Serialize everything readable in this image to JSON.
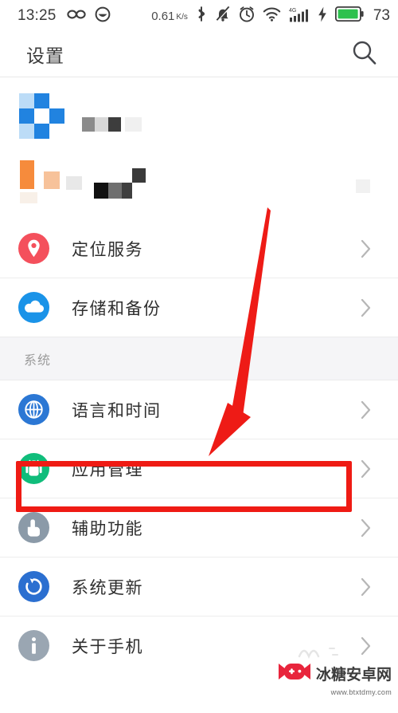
{
  "statusbar": {
    "time": "13:25",
    "net_speed_value": "0.61",
    "net_speed_unit": "K/s",
    "battery_percent": "73",
    "icons": [
      "infinity-icon",
      "smiley-icon",
      "bluetooth-icon",
      "mute-icon",
      "alarm-icon",
      "wifi-icon",
      "signal-4g-icon",
      "charging-bolt-icon",
      "battery-icon"
    ],
    "signal_label": "4G"
  },
  "header": {
    "title": "设置",
    "search_icon": "search-icon"
  },
  "list": {
    "censored_rows": [
      {
        "name": "censored-row-1",
        "icon_color": "#2586e0"
      },
      {
        "name": "censored-row-2",
        "icon_color": "#f68b3c"
      }
    ],
    "items": [
      {
        "label": "定位服务",
        "icon": "location-pin-icon",
        "icon_color": "#f4505c",
        "chevron": "chevron-right-icon",
        "highlighted": false
      },
      {
        "label": "存储和备份",
        "icon": "cloud-icon",
        "icon_color": "#1a93e8",
        "chevron": "chevron-right-icon",
        "highlighted": false
      }
    ],
    "section_title": "系统",
    "system_items": [
      {
        "label": "语言和时间",
        "icon": "globe-icon",
        "icon_color": "#2b77d4",
        "chevron": "chevron-right-icon",
        "highlighted": false
      },
      {
        "label": "应用管理",
        "icon": "android-robot-icon",
        "icon_color": "#10bd7b",
        "chevron": "chevron-right-icon",
        "highlighted": true
      },
      {
        "label": "辅助功能",
        "icon": "hand-pointer-icon",
        "icon_color": "#8b9aa8",
        "chevron": "chevron-right-icon",
        "highlighted": false
      },
      {
        "label": "系统更新",
        "icon": "refresh-icon",
        "icon_color": "#2b6fd0",
        "chevron": "chevron-right-icon",
        "highlighted": false
      },
      {
        "label": "关于手机",
        "icon": "info-icon",
        "icon_color": "#9aa6b2",
        "chevron": "chevron-right-icon",
        "highlighted": false
      }
    ]
  },
  "annotations": {
    "highlight_color": "#ef1b14",
    "arrow_color": "#ef1b14",
    "arrow_name": "red-pointer-arrow",
    "box_name": "red-highlight-box"
  },
  "watermark": {
    "site_name": "冰糖安卓网",
    "url": "www.btxtdmy.com",
    "logo_color": "#e8253c"
  }
}
